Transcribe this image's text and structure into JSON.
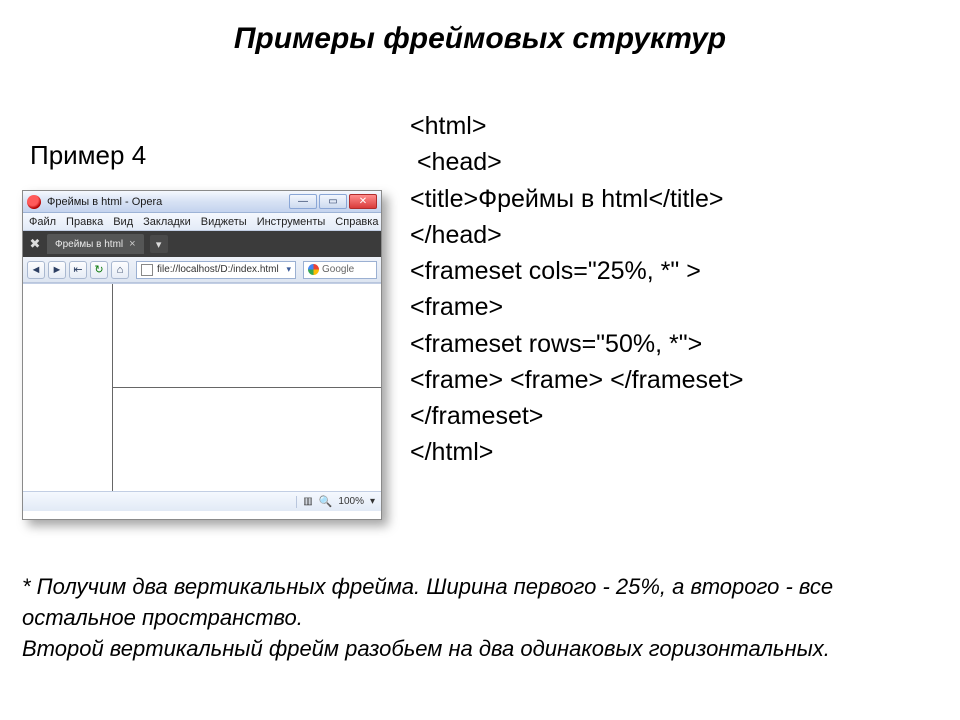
{
  "title": "Примеры фреймовых структур",
  "subtitle": "Пример 4",
  "browser": {
    "window_title": "Фреймы в html - Opera",
    "menu": [
      "Файл",
      "Правка",
      "Вид",
      "Закладки",
      "Виджеты",
      "Инструменты",
      "Справка"
    ],
    "tab_label": "Фреймы в html",
    "address": "file://localhost/D:/index.html",
    "search_engine": "Google",
    "zoom": "100%",
    "win_min": "—",
    "win_max": "▭",
    "win_close": "✕"
  },
  "code": {
    "l1": "<html>",
    "l2": " <head>",
    "l3": "<title>Фреймы в html</title>",
    "l4": "</head>",
    "l5": "<frameset cols=\"25%, *\" >",
    "l6": "<frame>",
    "l7": "<frameset rows=\"50%, *\">",
    "l8": "<frame> <frame> </frameset>",
    "l9": "</frameset>",
    "l10": "</html>"
  },
  "footnote": {
    "p1": "* Получим два вертикальных фрейма. Ширина первого - 25%, а второго - все остальное пространство.",
    "p2": "Второй вертикальный фрейм разобьем на два одинаковых горизонтальных."
  }
}
